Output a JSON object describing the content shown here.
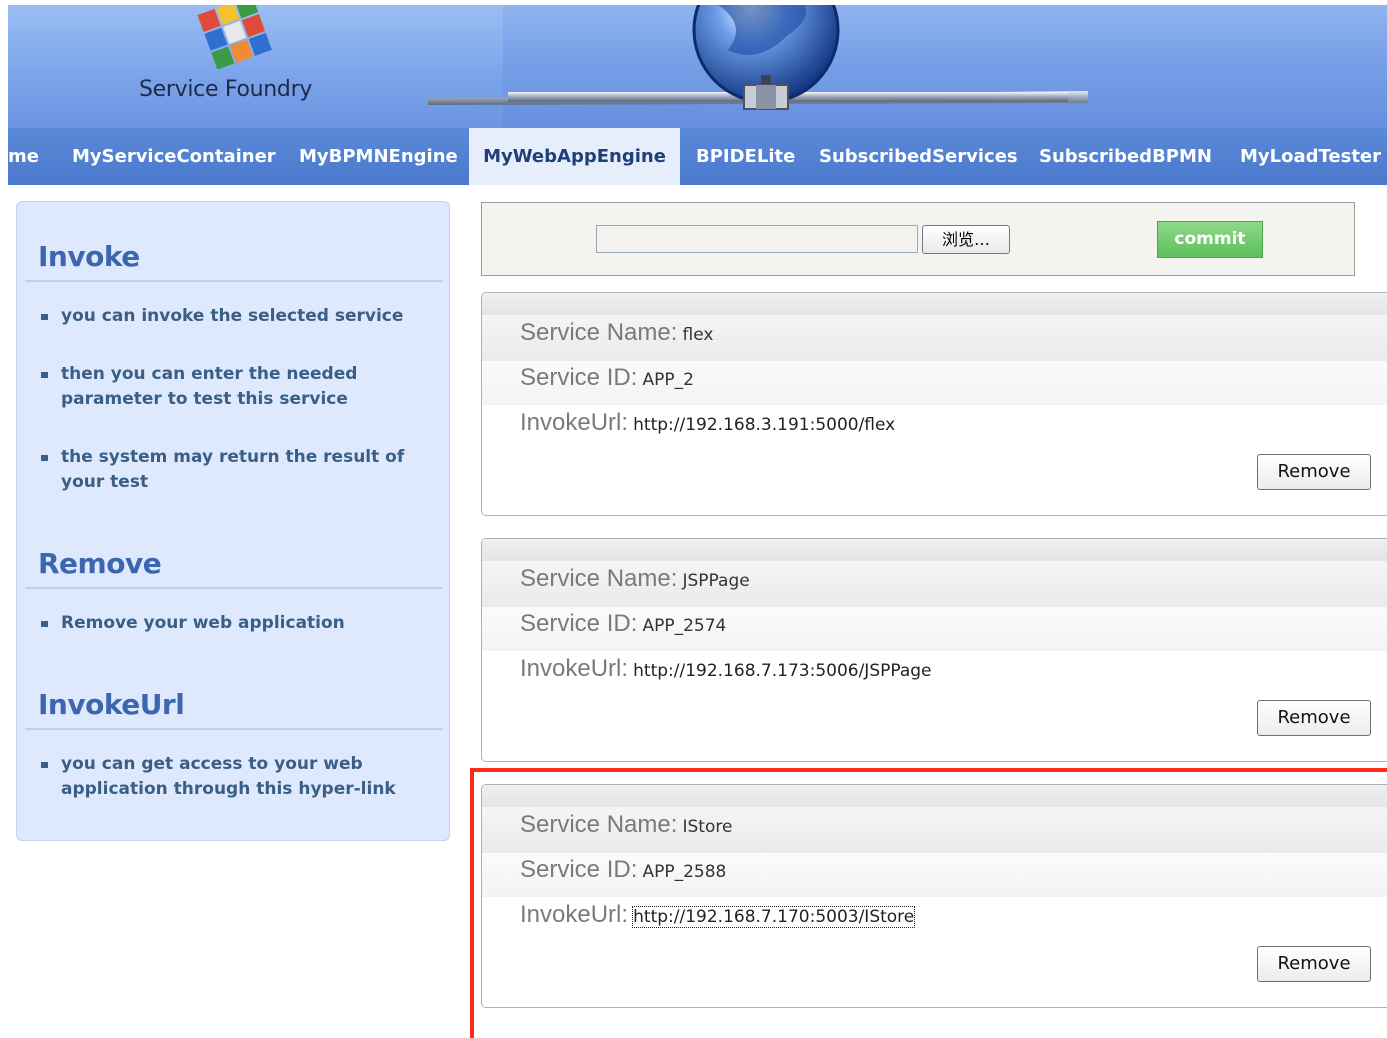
{
  "header": {
    "site_name": "Service Foundry"
  },
  "nav": {
    "items": [
      {
        "label": "me"
      },
      {
        "label": "MyServiceContainer"
      },
      {
        "label": "MyBPMNEngine"
      },
      {
        "label": "MyWebAppEngine",
        "active": true
      },
      {
        "label": "BPIDELite"
      },
      {
        "label": "SubscribedServices"
      },
      {
        "label": "SubscribedBPMN"
      },
      {
        "label": "MyLoadTester"
      }
    ]
  },
  "sidebar": {
    "invoke": {
      "title": "Invoke",
      "items": [
        "you can invoke the selected service",
        "then you can enter the needed parameter to test this service",
        "the system may return the result of your test"
      ]
    },
    "remove": {
      "title": "Remove",
      "items": [
        "Remove your web application"
      ]
    },
    "invokeurl": {
      "title": "InvokeUrl",
      "items": [
        "you can get access to your web application through this hyper-link"
      ]
    }
  },
  "upload": {
    "file_value": "",
    "browse_label": "浏览…",
    "commit_label": "commit"
  },
  "labels": {
    "service_name": "Service Name:",
    "service_id": "Service ID:",
    "invoke_url": "InvokeUrl:",
    "remove": "Remove"
  },
  "apps": [
    {
      "name": "flex",
      "id": "APP_2",
      "url": "http://192.168.3.191:5000/flex"
    },
    {
      "name": "JSPPage",
      "id": "APP_2574",
      "url": "http://192.168.7.173:5006/JSPPage"
    },
    {
      "name": "IStore",
      "id": "APP_2588",
      "url": "http://192.168.7.170:5003/IStore"
    }
  ],
  "colors": {
    "nav_bg": "#4a78cc",
    "nav_active_bg": "#e6eefc",
    "sidebar_bg": "#dfe9fd",
    "sidebar_heading": "#3d66b0",
    "commit_green": "#5cbf58",
    "highlight_red": "#ff2a1a"
  }
}
